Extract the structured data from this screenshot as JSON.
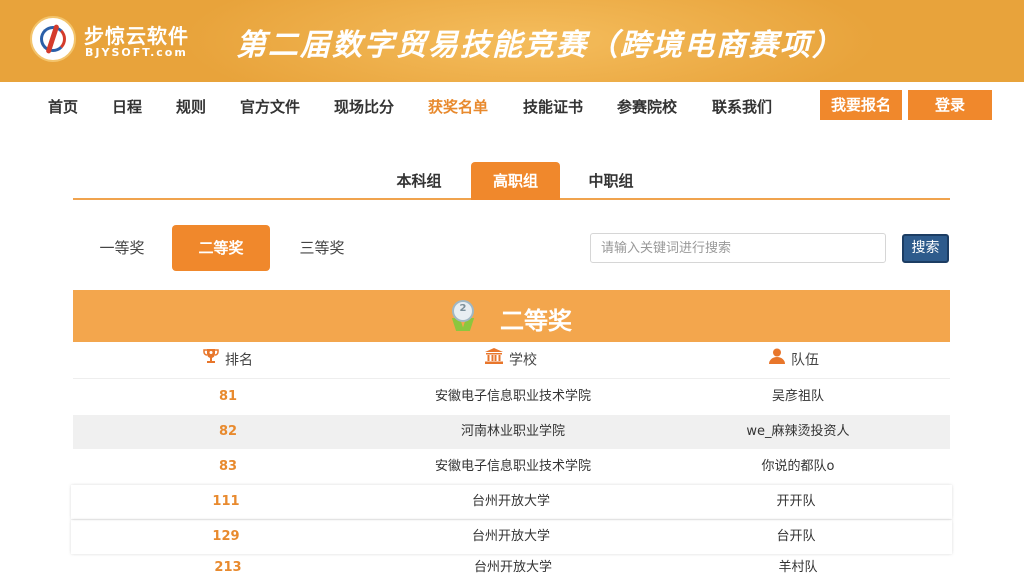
{
  "header": {
    "brand_name": "步惊云软件",
    "brand_sub": "BJYSOFT.com",
    "title": "第二届数字贸易技能竞赛（跨境电商赛项）"
  },
  "nav": {
    "items": [
      {
        "label": "首页"
      },
      {
        "label": "日程"
      },
      {
        "label": "规则"
      },
      {
        "label": "官方文件"
      },
      {
        "label": "现场比分"
      },
      {
        "label": "获奖名单",
        "active": true
      },
      {
        "label": "技能证书"
      },
      {
        "label": "参赛院校"
      },
      {
        "label": "联系我们"
      }
    ],
    "register_label": "我要报名",
    "login_label": "登录"
  },
  "group_tabs": [
    {
      "label": "本科组"
    },
    {
      "label": "高职组",
      "active": true
    },
    {
      "label": "中职组"
    }
  ],
  "prize_tabs": [
    {
      "label": "一等奖"
    },
    {
      "label": "二等奖",
      "active": true
    },
    {
      "label": "三等奖"
    }
  ],
  "search": {
    "placeholder": "请输入关键词进行搜索",
    "button_label": "搜索"
  },
  "panel": {
    "title": "二等奖",
    "medal_number": "2",
    "columns": {
      "rank": "排名",
      "school": "学校",
      "team": "队伍"
    }
  },
  "rows": [
    {
      "rank": "81",
      "school": "安徽电子信息职业技术学院",
      "team": "吴彦祖队"
    },
    {
      "rank": "82",
      "school": "河南林业职业学院",
      "team": "we_麻辣烫投资人"
    },
    {
      "rank": "83",
      "school": "安徽电子信息职业技术学院",
      "team": "你说的都队o"
    },
    {
      "rank": "111",
      "school": "台州开放大学",
      "team": "开开队"
    },
    {
      "rank": "129",
      "school": "台州开放大学",
      "team": "台开队"
    },
    {
      "rank": "213",
      "school": "台州开放大学",
      "team": "羊村队"
    }
  ],
  "colors": {
    "banner": "#e8a33b",
    "accent": "#f0882c",
    "panel_header": "#f3a64d",
    "search_button": "#2e5b8c"
  }
}
